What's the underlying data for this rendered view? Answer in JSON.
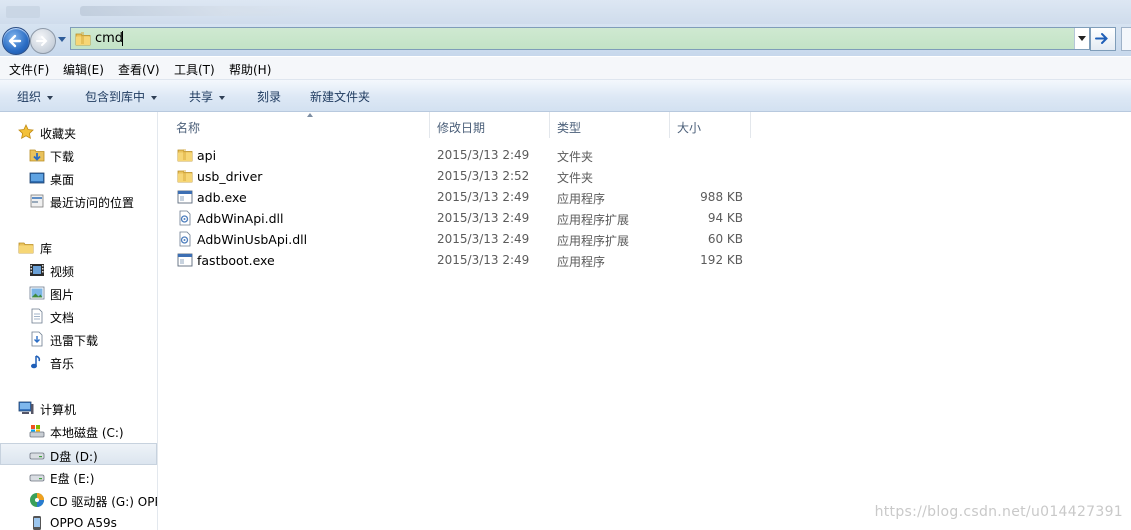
{
  "address_bar": {
    "path": "cmd"
  },
  "menu": [
    "文件(F)",
    "编辑(E)",
    "查看(V)",
    "工具(T)",
    "帮助(H)"
  ],
  "toolbar": [
    {
      "label": "组织",
      "dropdown": true
    },
    {
      "label": "包含到库中",
      "dropdown": true
    },
    {
      "label": "共享",
      "dropdown": true
    },
    {
      "label": "刻录",
      "dropdown": false
    },
    {
      "label": "新建文件夹",
      "dropdown": false
    }
  ],
  "sidebar": {
    "favorites": {
      "label": "收藏夹",
      "items": [
        "下载",
        "桌面",
        "最近访问的位置"
      ]
    },
    "libraries": {
      "label": "库",
      "items": [
        "视频",
        "图片",
        "文档",
        "迅雷下载",
        "音乐"
      ]
    },
    "computer": {
      "label": "计算机",
      "items": [
        "本地磁盘 (C:)",
        "D盘 (D:)",
        "E盘 (E:)",
        "CD 驱动器 (G:) OPP",
        "OPPO A59s"
      ],
      "selected_index": 1
    }
  },
  "columns": {
    "name": "名称",
    "date": "修改日期",
    "type": "类型",
    "size": "大小"
  },
  "files": [
    {
      "name": "api",
      "date": "2015/3/13 2:49",
      "type": "文件夹",
      "size": "",
      "icon": "folder-icon"
    },
    {
      "name": "usb_driver",
      "date": "2015/3/13 2:52",
      "type": "文件夹",
      "size": "",
      "icon": "folder-icon"
    },
    {
      "name": "adb.exe",
      "date": "2015/3/13 2:49",
      "type": "应用程序",
      "size": "988 KB",
      "icon": "exe-icon"
    },
    {
      "name": "AdbWinApi.dll",
      "date": "2015/3/13 2:49",
      "type": "应用程序扩展",
      "size": "94 KB",
      "icon": "dll-icon"
    },
    {
      "name": "AdbWinUsbApi.dll",
      "date": "2015/3/13 2:49",
      "type": "应用程序扩展",
      "size": "60 KB",
      "icon": "dll-icon"
    },
    {
      "name": "fastboot.exe",
      "date": "2015/3/13 2:49",
      "type": "应用程序",
      "size": "192 KB",
      "icon": "exe-icon"
    }
  ],
  "watermark": "https://blog.csdn.net/u014427391",
  "colors": {
    "address_bar_bg": "#c8e6c9",
    "selected_bg": "#dce5ef",
    "command_bar": "#d3e1f1"
  }
}
